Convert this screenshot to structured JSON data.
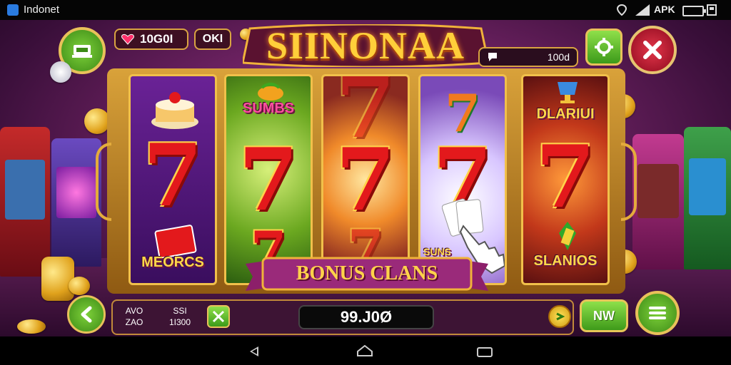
{
  "status_bar": {
    "app_name": "Indonet",
    "network_label": "APK",
    "icons": [
      "app-icon",
      "location-icon",
      "signal-icon",
      "battery-icon",
      "gallery-icon"
    ]
  },
  "game": {
    "title": "SIINONAA",
    "hud": {
      "gems": "10G0I",
      "gem_icon": "heart-gem-icon",
      "level_badge": "OKI",
      "right_pill_value": "100d",
      "home_icon": "machine-icon",
      "settings_icon": "gear-icon",
      "close_icon": "close-icon"
    },
    "reels": [
      {
        "top_symbol": "cake-icon",
        "middle": "7",
        "bottom_label": "MEORCS"
      },
      {
        "top_label": "SUMBS",
        "middle": "7",
        "bottom": "7"
      },
      {
        "top": "7",
        "middle": "7",
        "bottom": "7"
      },
      {
        "top": "7",
        "middle": "7",
        "bottom_label": "SUNS"
      },
      {
        "top_label": "DLARIUI",
        "middle": "7",
        "bottom_label": "SLANIOS"
      }
    ],
    "banner": "BONUS CLANS",
    "bottom": {
      "stat1_label": "AVO",
      "stat1_value": "ZAO",
      "stat2_label": "SSI",
      "stat2_value": "1I300",
      "win_value": "99.J0Ø",
      "new_button": "NW"
    }
  },
  "colors": {
    "background": "#6b2160",
    "gold": "#f1c04a",
    "seven_red": "#e3191c",
    "green_button": "#5fbf2a",
    "close_red": "#b5122a"
  }
}
